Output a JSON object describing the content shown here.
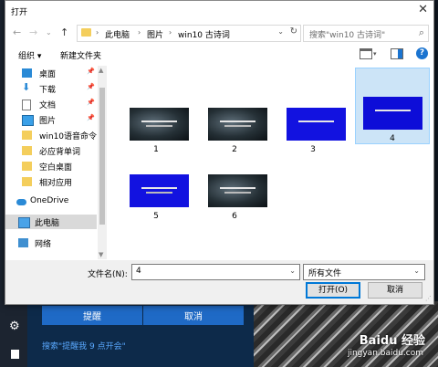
{
  "dialog": {
    "title": "打开"
  },
  "nav": {
    "breadcrumb": [
      "此电脑",
      "图片",
      "win10 古诗词"
    ],
    "search_placeholder": "搜索\"win10 古诗词\""
  },
  "toolbar": {
    "organize": "组织 ▾",
    "new_folder": "新建文件夹"
  },
  "sidebar": {
    "items": [
      {
        "label": "桌面",
        "icon": "desktop-icon",
        "pinned": true
      },
      {
        "label": "下载",
        "icon": "download-icon",
        "pinned": true
      },
      {
        "label": "文档",
        "icon": "document-icon",
        "pinned": true
      },
      {
        "label": "图片",
        "icon": "picture-icon",
        "pinned": true
      },
      {
        "label": "win10语音命令",
        "icon": "folder-icon"
      },
      {
        "label": "必应背单词",
        "icon": "folder-icon"
      },
      {
        "label": "空白桌面",
        "icon": "folder-icon"
      },
      {
        "label": "相对应用",
        "icon": "folder-icon"
      },
      {
        "label": "OneDrive",
        "icon": "cloud-icon"
      },
      {
        "label": "此电脑",
        "icon": "computer-icon",
        "selected": true
      },
      {
        "label": "网络",
        "icon": "network-icon"
      }
    ]
  },
  "files": [
    {
      "name": "1",
      "style": "dark"
    },
    {
      "name": "2",
      "style": "dark"
    },
    {
      "name": "3",
      "style": "blue"
    },
    {
      "name": "4",
      "style": "blue",
      "selected": true
    },
    {
      "name": "5",
      "style": "blue"
    },
    {
      "name": "6",
      "style": "dark"
    }
  ],
  "bottom": {
    "filename_label": "文件名(N):",
    "filename_value": "4",
    "filetype_value": "所有文件",
    "open_label": "打开(O)",
    "cancel_label": "取消"
  },
  "background": {
    "remind_label": "提醒",
    "cancel_label": "取消",
    "search_text": "搜索\"提醒我 9 点开会\"",
    "watermark": "Baidu 经验",
    "watermark_sub": "jingyan.baidu.com"
  },
  "colors": {
    "accent": "#0078d7",
    "selection": "#cce4f7",
    "bg_button": "#1f6ac6"
  }
}
